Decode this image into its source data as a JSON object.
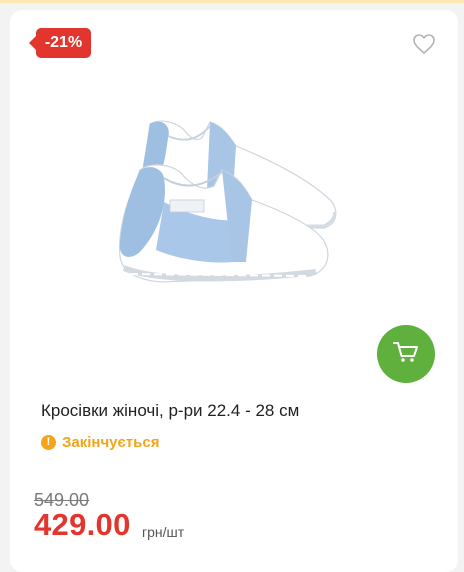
{
  "product": {
    "discount_badge": "-21%",
    "title": "Кросівки жіночі, р-ри 22.4 - 28 см",
    "stock_status": "Закінчується",
    "old_price": "549.00",
    "price": "429.00",
    "unit": "грн/шт"
  },
  "icons": {
    "favorite": "heart-outline-icon",
    "cart": "cart-icon",
    "stock_warning": "exclamation-circle-icon"
  },
  "colors": {
    "badge": "#e2352d",
    "price": "#e2352d",
    "cart_button": "#5fb03c",
    "stock_status": "#f4a418"
  }
}
